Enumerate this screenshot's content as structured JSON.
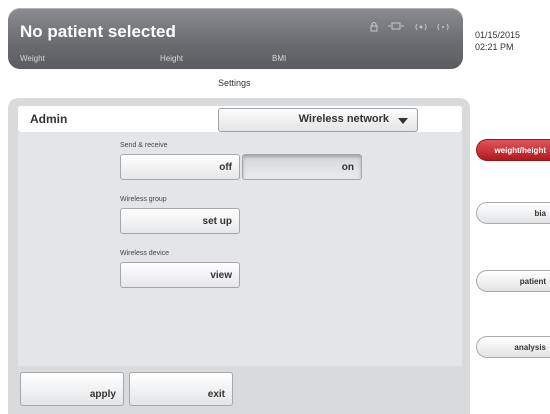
{
  "header": {
    "patient_status": "No patient selected",
    "metrics": {
      "weight": "Weight",
      "height": "Height",
      "bmi": "BMI"
    },
    "status_icons": [
      "lock-icon",
      "scale-icon",
      "signal-icon",
      "wireless-icon"
    ]
  },
  "datetime": {
    "date": "01/15/2015",
    "time": "02:21 PM"
  },
  "page": {
    "title": "Settings"
  },
  "panel": {
    "title": "Admin",
    "dropdown_value": "Wireless network",
    "send_receive": {
      "label": "Send & receive",
      "off": "off",
      "on": "on",
      "selected": "on"
    },
    "wireless_group": {
      "label": "Wireless group",
      "button": "set up"
    },
    "wireless_device": {
      "label": "Wireless device",
      "button": "view"
    }
  },
  "footer": {
    "apply": "apply",
    "exit": "exit"
  },
  "side_tabs": [
    {
      "label": "weight/height",
      "active": true
    },
    {
      "label": "bia",
      "active": false
    },
    {
      "label": "patient",
      "active": false
    },
    {
      "label": "analysis",
      "active": false
    }
  ],
  "colors": {
    "active_tab": "#c8262b",
    "header": "#6b6d70",
    "panel": "#d9dadc"
  }
}
